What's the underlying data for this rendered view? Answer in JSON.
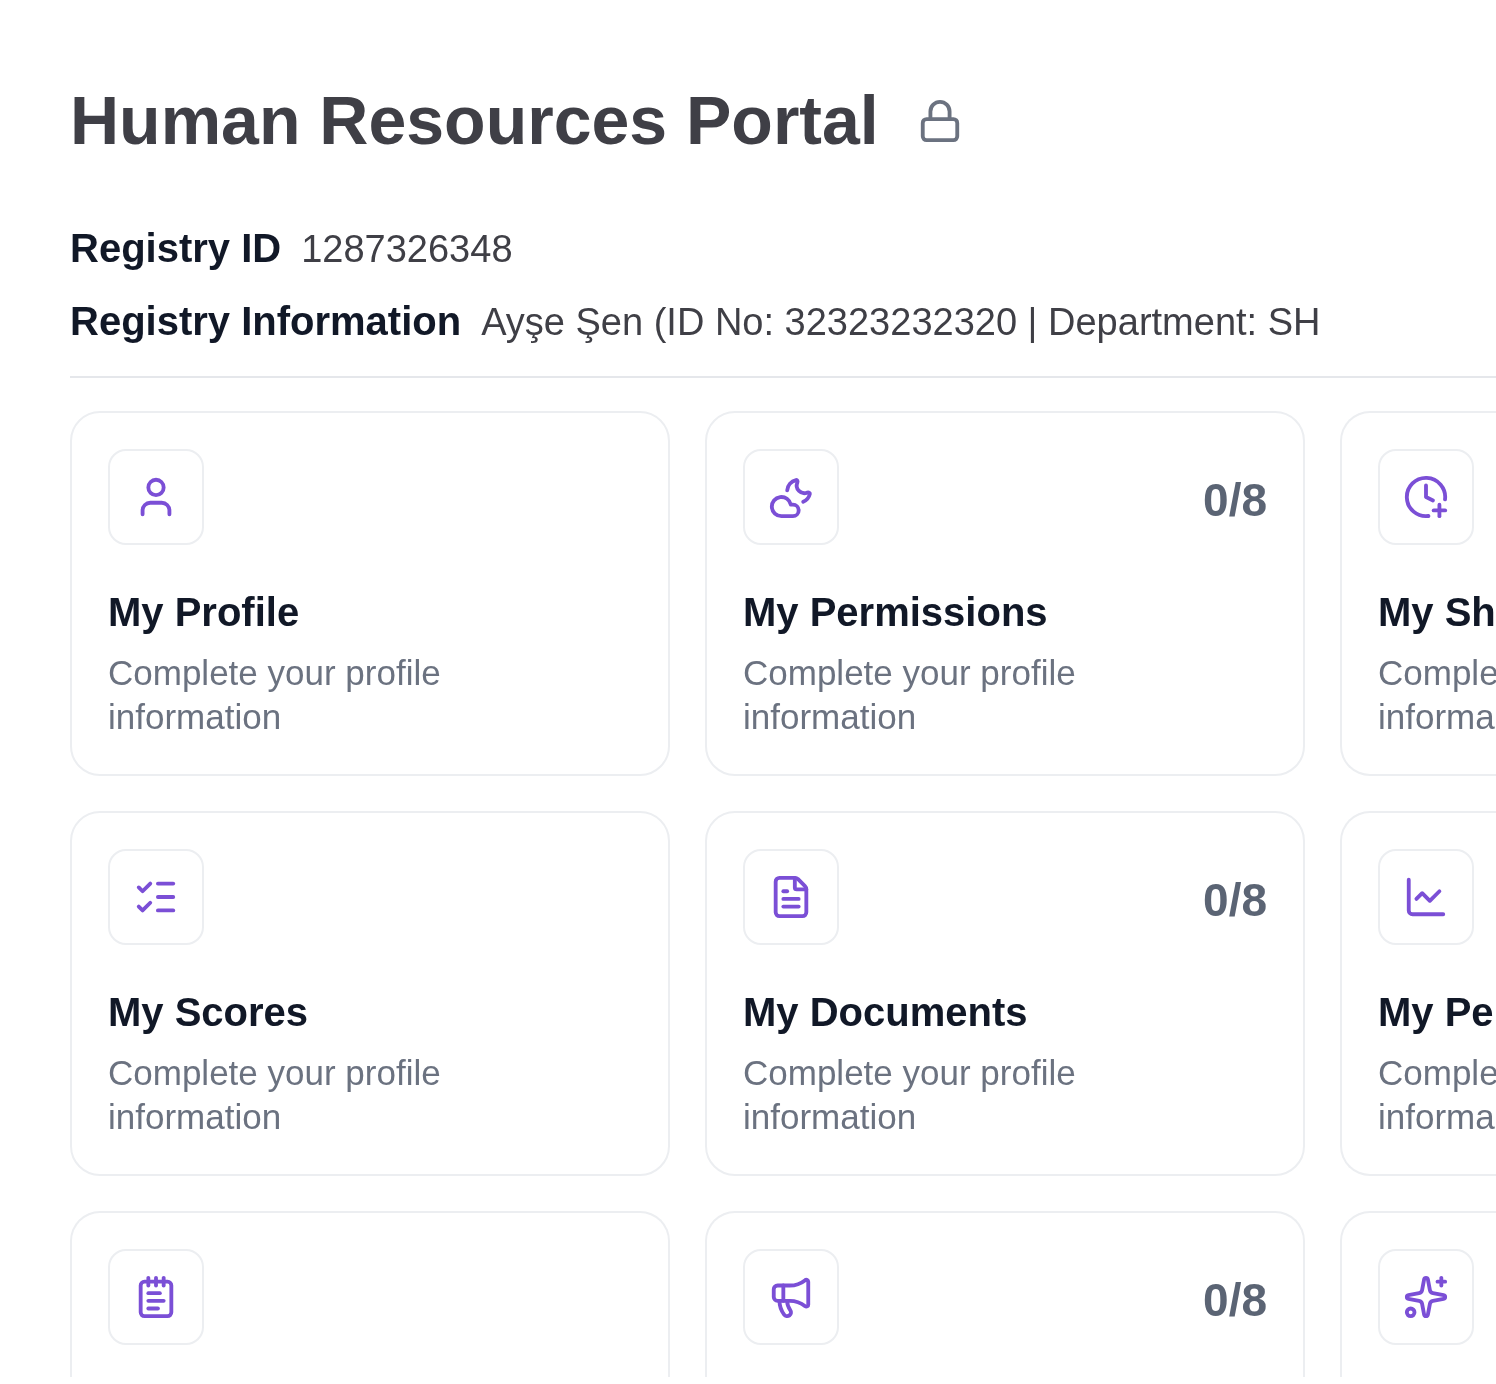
{
  "header": {
    "title": "Human Resources Portal"
  },
  "registry": [
    {
      "label": "Registry ID",
      "value": "1287326348"
    },
    {
      "label": "Registry Information",
      "value": "Ayşe Şen (ID No: 32323232320 | Department: SH"
    }
  ],
  "cards": [
    [
      {
        "kind": "profile",
        "title": "My Profile",
        "description": "Complete your profile information"
      },
      {
        "kind": "permissions",
        "title": "My Permissions",
        "description": "Complete your profile information",
        "count": "0/8"
      },
      {
        "kind": "shifts",
        "title": "My Sh",
        "description": "Comple\ninforma"
      }
    ],
    [
      {
        "kind": "scores",
        "title": "My Scores",
        "description": "Complete your profile information"
      },
      {
        "kind": "documents",
        "title": "My Documents",
        "description": "Complete your profile information",
        "count": "0/8"
      },
      {
        "kind": "performance",
        "title": "My Pe",
        "description": "Comple\ninforma"
      }
    ],
    [
      {
        "kind": "notes"
      },
      {
        "kind": "announcements",
        "count": "0/8"
      },
      {
        "kind": "highlights"
      }
    ]
  ]
}
